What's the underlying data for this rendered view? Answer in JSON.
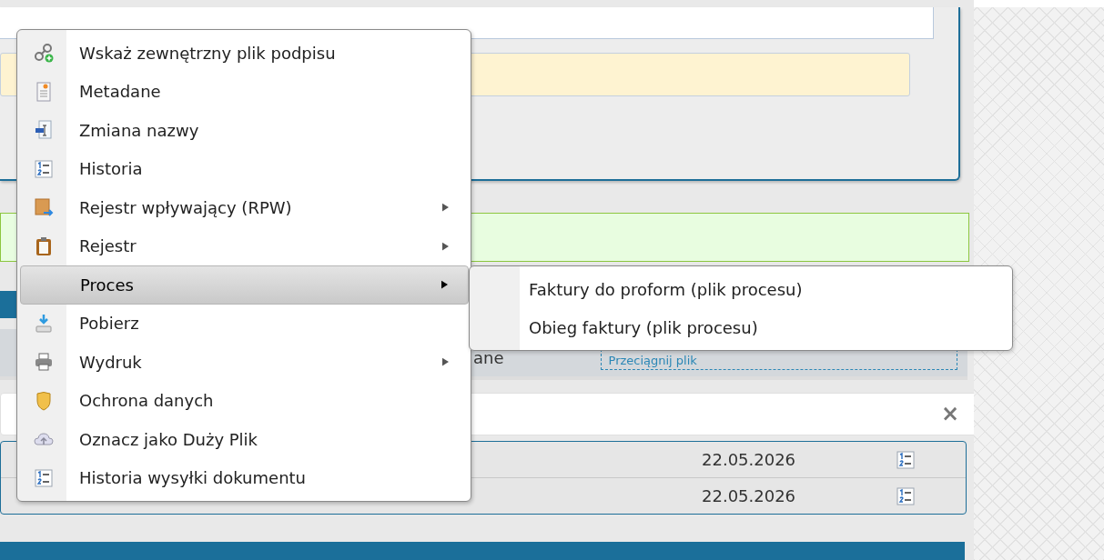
{
  "background": {
    "drop_zone": {
      "label": "Przeciągnij plik"
    },
    "column_text": "ane",
    "filter": {
      "clear": "×"
    },
    "rows": [
      {
        "date": "22.05.2026"
      },
      {
        "date": "22.05.2026"
      }
    ]
  },
  "context_menu": {
    "items": [
      {
        "label": "Wskaż zewnętrzny plik podpisu",
        "kind": "link",
        "submenu": false,
        "selected": false
      },
      {
        "label": "Metadane",
        "kind": "metadata",
        "submenu": false,
        "selected": false
      },
      {
        "label": "Zmiana nazwy",
        "kind": "rename",
        "submenu": false,
        "selected": false
      },
      {
        "label": "Historia",
        "kind": "list",
        "submenu": false,
        "selected": false
      },
      {
        "label": "Rejestr wpływający (RPW)",
        "kind": "box",
        "submenu": true,
        "selected": false
      },
      {
        "label": "Rejestr",
        "kind": "clipboard",
        "submenu": true,
        "selected": false
      },
      {
        "label": "Proces",
        "kind": "none",
        "submenu": true,
        "selected": true
      },
      {
        "label": "Pobierz",
        "kind": "download",
        "submenu": false,
        "selected": false
      },
      {
        "label": "Wydruk",
        "kind": "printer",
        "submenu": true,
        "selected": false
      },
      {
        "label": "Ochrona danych",
        "kind": "shield",
        "submenu": false,
        "selected": false
      },
      {
        "label": "Oznacz jako Duży Plik",
        "kind": "cloud",
        "submenu": false,
        "selected": false
      },
      {
        "label": "Historia wysyłki dokumentu",
        "kind": "list",
        "submenu": false,
        "selected": false
      }
    ]
  },
  "submenu": {
    "items": [
      {
        "label": "Faktury do proform (plik procesu)",
        "selected": false
      },
      {
        "label": "Obieg faktury (plik procesu)",
        "selected": false
      }
    ]
  }
}
